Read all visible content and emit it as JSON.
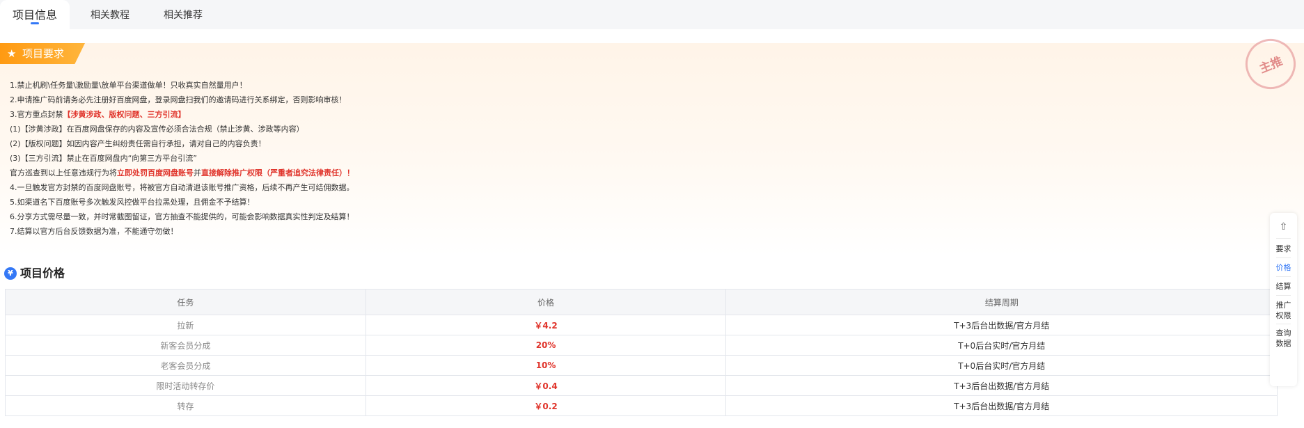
{
  "tabs": [
    {
      "label": "项目信息",
      "active": true
    },
    {
      "label": "相关教程",
      "active": false
    },
    {
      "label": "相关推荐",
      "active": false
    }
  ],
  "requirements": {
    "title": "项目要求",
    "stamp": "主推",
    "lines": [
      {
        "parts": [
          {
            "text": "1.禁止机刷\\任务量\\激励量\\放单平台渠道做单！只收真实自然量用户！",
            "highlight": false
          }
        ]
      },
      {
        "parts": [
          {
            "text": "2.申请推广码前请务必先注册好百度网盘，登录网盘扫我们的邀请码进行关系绑定，否则影响审核！",
            "highlight": false
          }
        ]
      },
      {
        "parts": [
          {
            "text": "3.官方重点封禁",
            "highlight": false
          },
          {
            "text": "【涉黄涉政、版权问题、三方引流】",
            "highlight": true
          }
        ]
      },
      {
        "parts": [
          {
            "text": "(1)【涉黄涉政】在百度网盘保存的内容及宣传必须合法合规（禁止涉黄、涉政等内容）",
            "highlight": false
          }
        ]
      },
      {
        "parts": [
          {
            "text": "(2)【版权问题】如因内容产生纠纷责任需自行承担，请对自己的内容负责！",
            "highlight": false
          }
        ]
      },
      {
        "parts": [
          {
            "text": "(3)【三方引流】禁止在百度网盘内“向第三方平台引流”",
            "highlight": false
          }
        ]
      },
      {
        "parts": [
          {
            "text": "官方巡查到以上任意违规行为将",
            "highlight": false
          },
          {
            "text": "立即处罚百度网盘账号",
            "highlight": true
          },
          {
            "text": "并",
            "highlight": false
          },
          {
            "text": "直接解除推广权限（严重者追究法律责任）！",
            "highlight": true
          }
        ]
      },
      {
        "parts": [
          {
            "text": "4.一旦触发官方封禁的百度网盘账号，将被官方自动清退该账号推广资格，后续不再产生可结佣数据。",
            "highlight": false
          }
        ]
      },
      {
        "parts": [
          {
            "text": "5.如渠道名下百度账号多次触发风控做平台拉黑处理，且佣金不予结算！",
            "highlight": false
          }
        ]
      },
      {
        "parts": [
          {
            "text": "6.分享方式需尽量一致，并时常截图留证，官方抽查不能提供的，可能会影响数据真实性判定及结算！",
            "highlight": false
          }
        ]
      },
      {
        "parts": [
          {
            "text": "7.结算以官方后台反馈数据为准，不能通守勿做！",
            "highlight": false
          }
        ]
      }
    ]
  },
  "price": {
    "title": "项目价格",
    "icon": "yen-icon",
    "headers": [
      "任务",
      "价格",
      "结算周期"
    ],
    "rows": [
      {
        "task": "拉新",
        "price": "￥4.2",
        "cycle": "T+3后台出数据/官方月结"
      },
      {
        "task": "新客会员分成",
        "price": "20%",
        "cycle": "T+0后台实时/官方月结"
      },
      {
        "task": "老客会员分成",
        "price": "10%",
        "cycle": "T+0后台实时/官方月结"
      },
      {
        "task": "限时活动转存价",
        "price": "￥0.4",
        "cycle": "T+3后台出数据/官方月结"
      },
      {
        "task": "转存",
        "price": "￥0.2",
        "cycle": "T+3后台出数据/官方月结"
      }
    ]
  },
  "sidenav": {
    "top_icon": "back-to-top-icon",
    "items": [
      {
        "label": "要求",
        "active": false
      },
      {
        "label": "价格",
        "active": true
      },
      {
        "label": "结算",
        "active": false
      },
      {
        "label": "推广\n权限",
        "active": false
      },
      {
        "label": "查询\n数据",
        "active": false
      }
    ]
  },
  "colors": {
    "accent": "#3478f6",
    "highlight": "#e0342b",
    "badge": "#ff9a12"
  }
}
